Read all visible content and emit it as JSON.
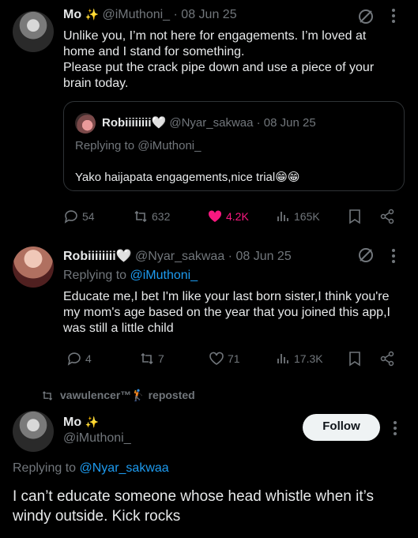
{
  "tweet1": {
    "name": "Mo",
    "emoji": "✨",
    "handle": "@iMuthoni_",
    "date": "· 08 Jun 25",
    "text": "Unlike you, I’m not here for engagements. I’m loved at home and I stand for something.\nPlease put the crack pipe down and use a piece of your brain today.",
    "quote": {
      "name": "Robiiiiiiii",
      "heart": "🤍",
      "handle": "@Nyar_sakwaa",
      "date": "· 08 Jun 25",
      "replying": "Replying to @iMuthoni_",
      "text": "Yako haijapata engagements,nice trial",
      "emojis": "😁😁"
    },
    "actions": {
      "replies": "54",
      "reposts": "632",
      "likes": "4.2K",
      "views": "165K"
    }
  },
  "tweet2": {
    "name": "Robiiiiiiii",
    "heart": "🤍",
    "handle": "@Nyar_sakwaa",
    "date": "· 08 Jun 25",
    "replying_prefix": "Replying to ",
    "replying_handle": "@iMuthoni_",
    "text": "Educate me,I bet I'm like your last born sister,I think you're my mom's age based on the year that you joined this app,I was still a little child",
    "actions": {
      "replies": "4",
      "reposts": "7",
      "likes": "71",
      "views": "17.3K"
    }
  },
  "repost_banner": {
    "user": "vawulencer™",
    "emoji": "🏌",
    "text": "reposted"
  },
  "tweet3": {
    "name": "Mo",
    "emoji": "✨",
    "handle": "@iMuthoni_",
    "follow_label": "Follow",
    "replying_prefix": "Replying to ",
    "replying_handle": "@Nyar_sakwaa",
    "text": "I can’t educate someone whose head whistle when it’s windy outside. Kick rocks"
  },
  "colors": {
    "accent": "#1d9bf0",
    "like": "#f91880",
    "muted": "#71767b",
    "text": "#e7e9ea",
    "background": "#000000"
  }
}
